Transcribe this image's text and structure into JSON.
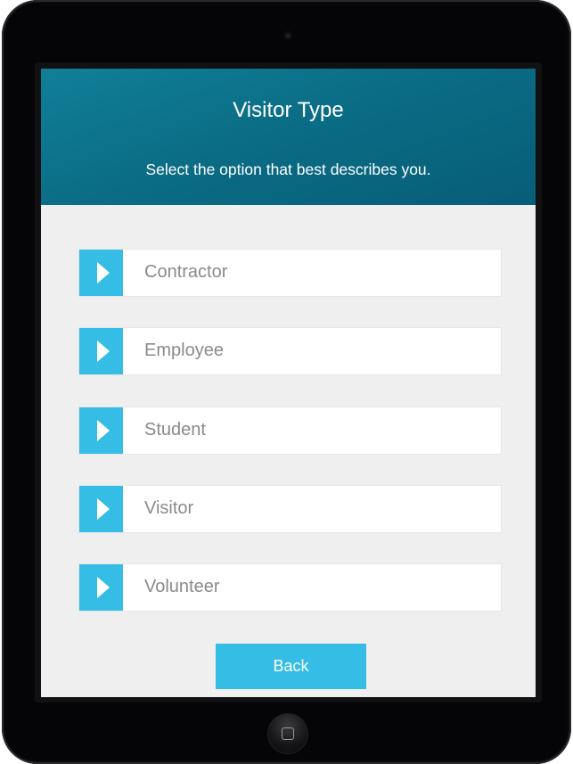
{
  "header": {
    "title": "Visitor Type",
    "subtitle": "Select the option that best describes you."
  },
  "options": [
    {
      "label": "Contractor",
      "icon": "play-arrow-icon"
    },
    {
      "label": "Employee",
      "icon": "play-arrow-icon"
    },
    {
      "label": "Student",
      "icon": "play-arrow-icon"
    },
    {
      "label": "Visitor",
      "icon": "play-arrow-icon"
    },
    {
      "label": "Volunteer",
      "icon": "play-arrow-icon"
    }
  ],
  "footer": {
    "back_label": "Back"
  },
  "colors": {
    "header_bg": "#0b6d86",
    "accent": "#35bde6",
    "screen_bg": "#efefef",
    "option_text": "#8a8a8a"
  }
}
